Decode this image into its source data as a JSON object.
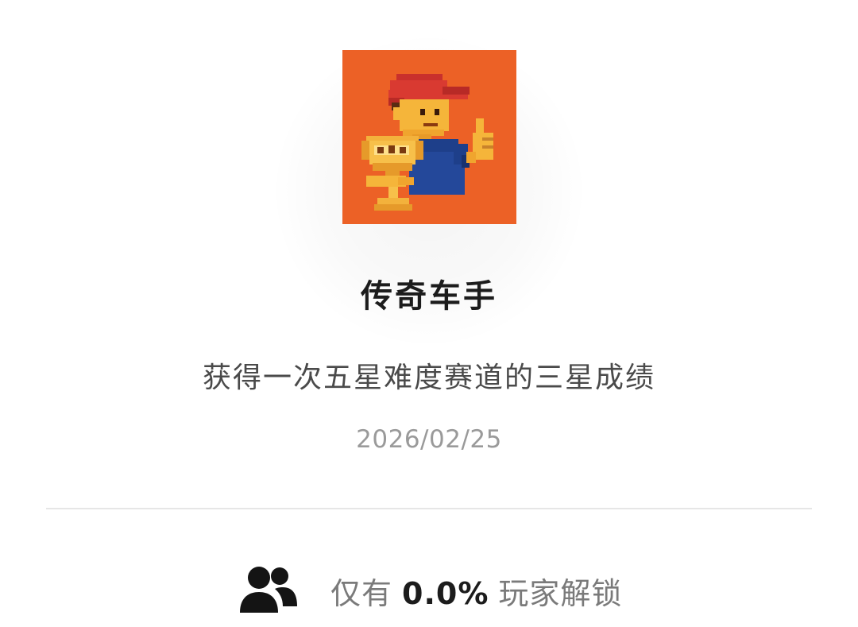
{
  "achievement": {
    "badge_icon": "pixel-racer-trophy-icon",
    "badge_color": "#ec6126",
    "title": "传奇车手",
    "description": "获得一次五星难度赛道的三星成绩",
    "date": "2026/02/25"
  },
  "stats": {
    "icon": "users-icon",
    "prefix": "仅有",
    "percent": "0.0%",
    "suffix": "玩家解锁"
  }
}
